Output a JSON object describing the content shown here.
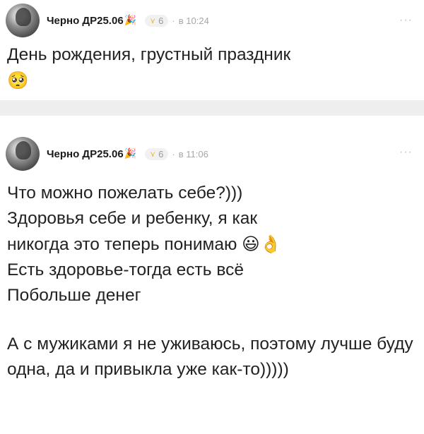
{
  "posts": [
    {
      "author": "Черно ДР25.06",
      "author_emoji": "🎉",
      "badge_icon": "wings-icon",
      "badge_count": "6",
      "separator": "·",
      "time": "в 10:24",
      "more": "···",
      "text": "День рождения, грустный праздник",
      "text_emoji": "🥺"
    },
    {
      "author": "Черно ДР25.06",
      "author_emoji": "🎉",
      "badge_icon": "wings-icon",
      "badge_count": "6",
      "separator": "·",
      "time": "в 11:06",
      "more": "···",
      "lines": [
        "Что можно пожелать себе?)))",
        "Здоровья себе и ребенку, я как",
        "никогда это теперь понимаю",
        "Есть здоровье-тогда есть всё",
        "Побольше денег"
      ],
      "line3_emojis": "😃👌",
      "paragraph2": "А с мужиками я не уживаюсь, поэтому лучше буду одна, да и привыкла уже как-то)))))"
    }
  ]
}
